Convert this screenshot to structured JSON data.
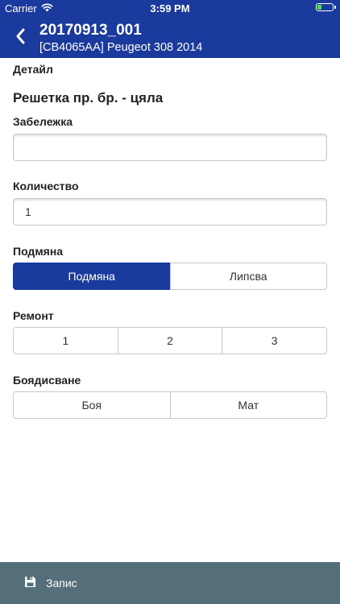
{
  "status_bar": {
    "carrier": "Carrier",
    "time": "3:59 PM",
    "icons": [
      "wifi-icon",
      "battery-icon"
    ]
  },
  "nav": {
    "title": "20170913_001",
    "subtitle": "[CB4065AA] Peugeot 308 2014",
    "back_icon": "chevron-left-icon"
  },
  "form": {
    "detail_label": "Детайл",
    "part_name": "Решетка пр. бр. - цяла",
    "note_label": "Забележка",
    "note_value": "",
    "quantity_label": "Количество",
    "quantity_value": "1",
    "replace": {
      "label": "Подмяна",
      "options": [
        "Подмяна",
        "Липсва"
      ],
      "selected": "Подмяна"
    },
    "repair": {
      "label": "Ремонт",
      "options": [
        "1",
        "2",
        "3"
      ],
      "selected": ""
    },
    "paint": {
      "label": "Боядисване",
      "options": [
        "Боя",
        "Мат"
      ],
      "selected": ""
    }
  },
  "bottom_bar": {
    "save_label": "Запис",
    "save_icon": "floppy-disk-icon"
  },
  "colors": {
    "primary": "#1b3a9e",
    "bottom_bar": "#546e7a",
    "border": "#c8c8c8",
    "battery_level": "#4cd964"
  }
}
